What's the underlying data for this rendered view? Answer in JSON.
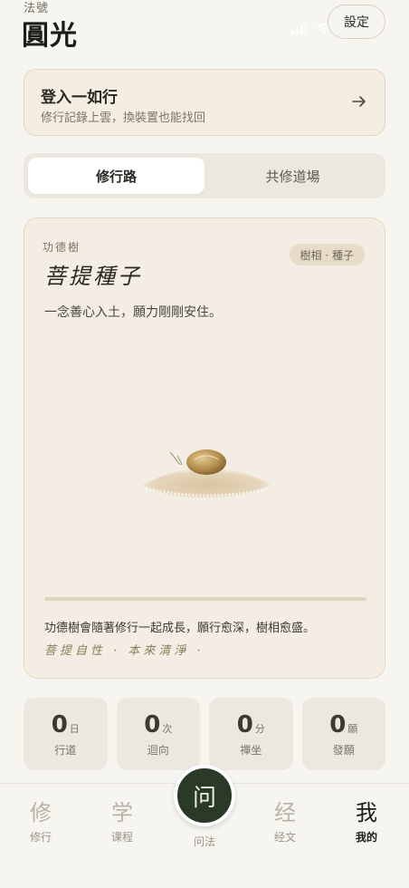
{
  "header": {
    "dharma_label": "法號",
    "dharma_name": "圓光",
    "settings_label": "設定"
  },
  "login": {
    "title": "登入一如行",
    "subtitle": "修行記錄上雲，換裝置也能找回"
  },
  "segments": {
    "active": "修行路",
    "inactive": "共修道場"
  },
  "tree": {
    "kicker": "功德樹",
    "stage_name": "菩提種子",
    "badge": "樹相 · 種子",
    "description": "一念善心入土，願力剛剛安住。",
    "progress": 0,
    "footer": "功德樹會隨著修行一起成長，願行愈深，樹相愈盛。",
    "verse": "菩提自性 · 本來清淨 ·"
  },
  "stats": [
    {
      "value": "0",
      "unit": "日",
      "label": "行道"
    },
    {
      "value": "0",
      "unit": "次",
      "label": "迴向"
    },
    {
      "value": "0",
      "unit": "分",
      "label": "禪坐"
    },
    {
      "value": "0",
      "unit": "願",
      "label": "發願"
    }
  ],
  "tabbar": {
    "items": [
      {
        "glyph": "修",
        "label": "修行"
      },
      {
        "glyph": "学",
        "label": "课程"
      },
      {
        "glyph": "经",
        "label": "经文"
      },
      {
        "glyph": "我",
        "label": "我的"
      }
    ],
    "center_glyph": "问",
    "center_label": "问法",
    "active": "我的"
  },
  "colors": {
    "background": "#f7f5ef",
    "card": "#f3ede3",
    "accent_dark": "#2b3a26"
  }
}
